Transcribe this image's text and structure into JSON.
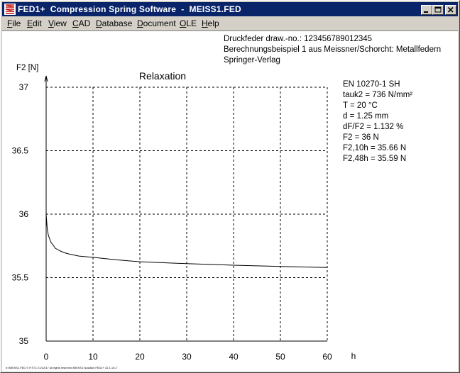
{
  "window": {
    "title": "FED1+  Compression Spring Software  -  MEISS1.FED",
    "app_icon": "spring-icon",
    "controls": [
      "minimize-icon",
      "maximize-icon",
      "close-icon"
    ]
  },
  "menu": [
    {
      "label": "File",
      "mnemonic": "F",
      "rest": "ile"
    },
    {
      "label": "Edit",
      "mnemonic": "E",
      "rest": "dit"
    },
    {
      "label": "View",
      "mnemonic": "V",
      "rest": "iew"
    },
    {
      "label": "CAD",
      "mnemonic": "C",
      "rest": "AD"
    },
    {
      "label": "Database",
      "mnemonic": "D",
      "rest": "atabase"
    },
    {
      "label": "Document",
      "mnemonic": "D",
      "rest": "ocument"
    },
    {
      "label": "OLE",
      "mnemonic": "O",
      "rest": "LE"
    },
    {
      "label": "Help",
      "mnemonic": "H",
      "rest": "elp"
    }
  ],
  "header": {
    "line1": "Druckfeder  draw.-no.: 123456789012345",
    "line2": "Berechnungsbeispiel 1 aus Meissner/Schorcht: Metallfedern",
    "line3": "Springer-Verlag"
  },
  "specs": [
    "EN 10270-1 SH",
    "tauk2 = 736 N/mm²",
    "T = 20 °C",
    "d = 1.25 mm",
    "dF/F2 = 1.132 %",
    "F2 = 36 N",
    "F2,10h = 35.66 N",
    "F2,48h = 35.59 N"
  ],
  "footer_text": "e:\\MEISS1.FED  © HTTC  21/12/17  all rights reserved  MEISS1  Isolation  FED1+  42.1.10.2",
  "chart_data": {
    "type": "line",
    "title": "Relaxation",
    "xlabel": "h",
    "ylabel": "F2 [N]",
    "xlim": [
      0,
      60
    ],
    "ylim": [
      35,
      37
    ],
    "xticks": [
      "0",
      "10",
      "20",
      "30",
      "40",
      "50",
      "60"
    ],
    "yticks": [
      "35",
      "35.5",
      "36",
      "36.5",
      "37"
    ],
    "grid": true,
    "series": [
      {
        "x": [
          0,
          0.25,
          0.5,
          1,
          2,
          3,
          4,
          5,
          7,
          10,
          15,
          20,
          30,
          40,
          48,
          50,
          60
        ],
        "values": [
          36.0,
          35.88,
          35.83,
          35.78,
          35.73,
          35.71,
          35.695,
          35.685,
          35.67,
          35.66,
          35.64,
          35.625,
          35.61,
          35.598,
          35.59,
          35.588,
          35.58
        ]
      }
    ]
  }
}
